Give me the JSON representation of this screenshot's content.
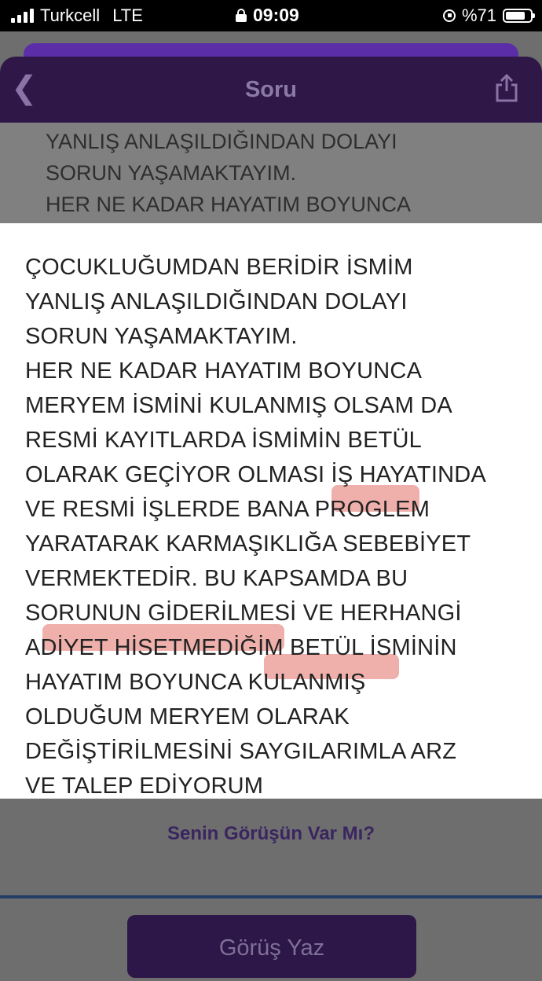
{
  "status_bar": {
    "carrier": "Turkcell",
    "network": "LTE",
    "time": "09:09",
    "battery": "%71"
  },
  "header": {
    "back_icon": "chevron-left-icon",
    "title": "Soru",
    "share_icon": "share-icon"
  },
  "background_text": "YANLIŞ ANLAŞILDIĞINDAN DOLAYI\nSORUN YAŞAMAKTAYIM.\nHER NE KADAR HAYATIM BOYUNCA",
  "question_text": "ÇOCUKLUĞUMDAN BERİDİR İSMİM\nYANLIŞ ANLAŞILDIĞINDAN DOLAYI\nSORUN YAŞAMAKTAYIM.\nHER NE KADAR HAYATIM BOYUNCA\nMERYEM İSMİNİ KULANMIŞ OLSAM DA\nRESMİ KAYITLARDA İSMİMİN BETÜL\nOLARAK GEÇİYOR OLMASI İŞ HAYATINDA\nVE RESMİ İŞLERDE BANA PROGLEM\nYARATARAK KARMAŞIKLIĞA SEBEBİYET\nVERMEKTEDİR. BU KAPSAMDA BU\nSORUNUN GİDERİLMESİ VE HERHANGİ\nADİYET HİSETMEDİĞİM BETÜL İSMİNİN\nHAYATIM BOYUNCA KULANMIŞ\nOLDUĞUM MERYEM OLARAK\nDEĞİŞTİRİLMESİNİ SAYGILARIMLA ARZ\nVE TALEP EDİYORUM",
  "opinion_prompt": "Senin Görüşün Var Mı?",
  "write_button": "Görüş Yaz",
  "colors": {
    "header_bg": "#2f1747",
    "accent_purple": "#5b2ea8",
    "highlight": "#dc5046"
  }
}
